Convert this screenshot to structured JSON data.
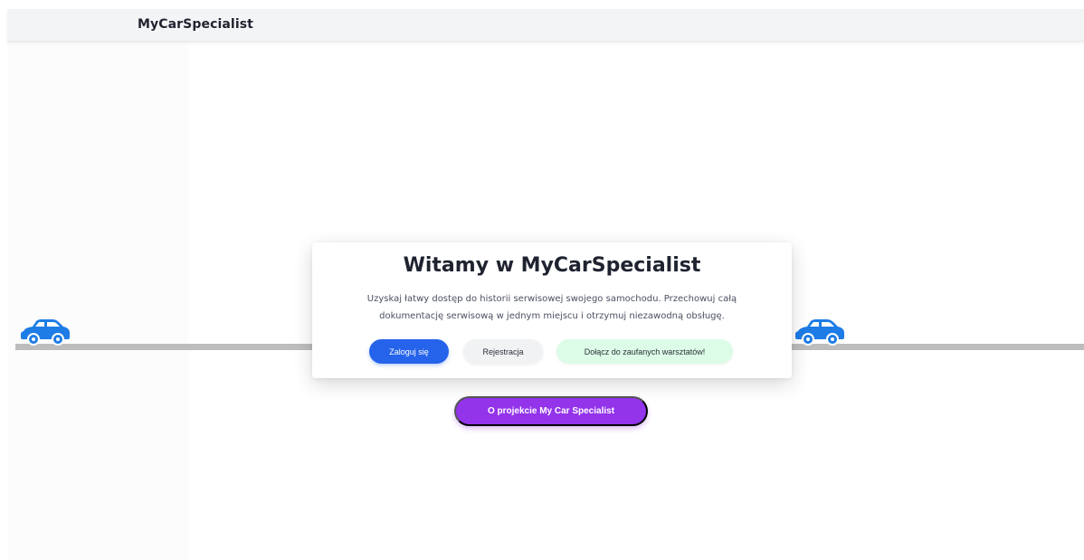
{
  "navbar": {
    "brand": "MyCarSpecialist"
  },
  "hero": {
    "title": "Witamy w MyCarSpecialist",
    "description": "Uzyskaj łatwy dostęp do historii serwisowej swojego samochodu. Przechowuj całą dokumentację serwisową w jednym miejscu i otrzymuj niezawodną obsługę.",
    "buttons": {
      "login": "Zaloguj się",
      "register": "Rejestracja",
      "join": "Dołącz do zaufanych warsztatów!"
    }
  },
  "about_button": "O projekcie My Car Specialist",
  "icons": {
    "car_left": "car-icon",
    "car_right": "car-icon"
  },
  "colors": {
    "primary": "#2563eb",
    "secondary": "#f1f2f4",
    "success_soft": "#dcfce7",
    "accent": "#9333ea",
    "car": "#1d7ce6",
    "road": "#bdbdbd"
  }
}
